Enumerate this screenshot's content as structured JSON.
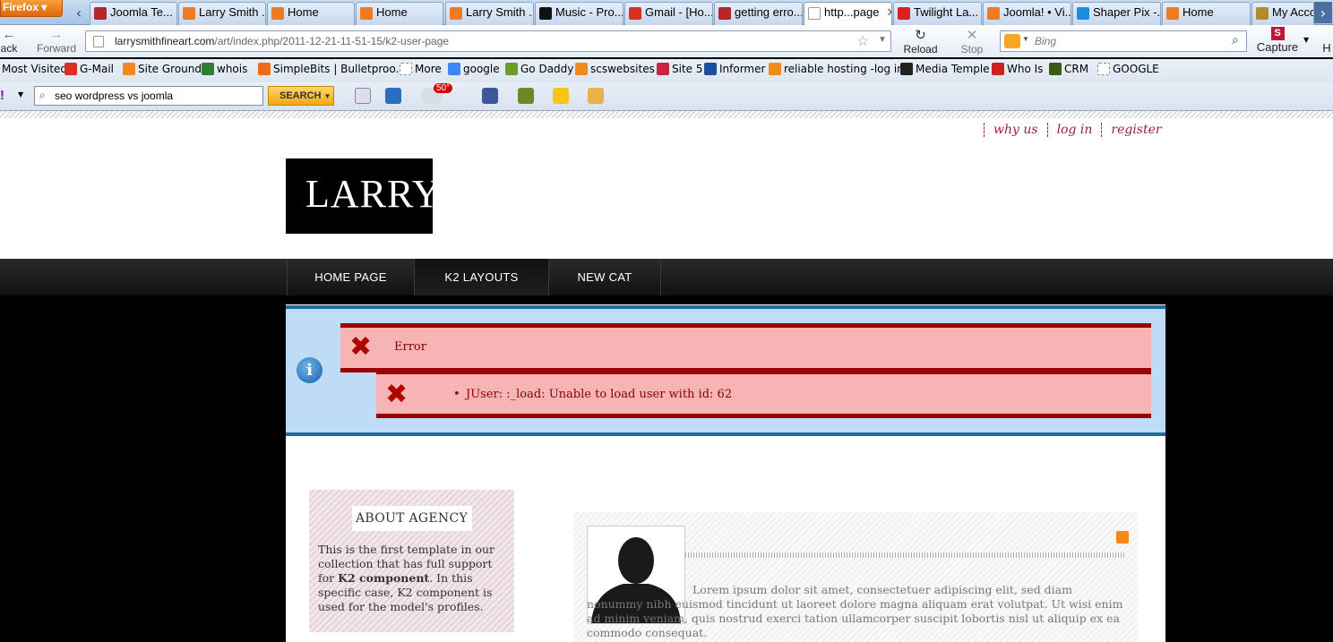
{
  "browser": {
    "app_button": "Firefox",
    "tabs": [
      {
        "label": "Joomla Te...",
        "icon": "pinterest-favicon",
        "color": "#b5262b"
      },
      {
        "label": "Larry Smith ...",
        "icon": "joomla-favicon",
        "color": "#ef7a1f"
      },
      {
        "label": "Home",
        "icon": "joomla-favicon",
        "color": "#ef7a1f"
      },
      {
        "label": "Home",
        "icon": "joomla-favicon",
        "color": "#ef7a1f"
      },
      {
        "label": "Larry Smith ...",
        "icon": "joomla-favicon",
        "color": "#ef7a1f"
      },
      {
        "label": "Music - Pro...",
        "icon": "g-favicon",
        "color": "#111111"
      },
      {
        "label": "Gmail - [Ho...",
        "icon": "gmail-favicon",
        "color": "#d93025"
      },
      {
        "label": "getting erro...",
        "icon": "pinterest-favicon",
        "color": "#b5262b"
      },
      {
        "label": "http...page",
        "icon": "blank-page-favicon",
        "color": "#ffffff",
        "active": true
      },
      {
        "label": "Twilight La...",
        "icon": "f-favicon",
        "color": "#e02020"
      },
      {
        "label": "Joomla! • Vi...",
        "icon": "joomla-favicon",
        "color": "#ef7a1f"
      },
      {
        "label": "Shaper Pix -...",
        "icon": "shaper-favicon",
        "color": "#1b8ee0"
      },
      {
        "label": "Home",
        "icon": "joomla-favicon",
        "color": "#ef7a1f"
      },
      {
        "label": "My Acco",
        "icon": "account-favicon",
        "color": "#b38b2c"
      }
    ],
    "nav": {
      "back": "ack",
      "forward": "Forward",
      "url_host": "larrysmithfineart.com",
      "url_path": "/art/index.php/2011-12-21-11-51-15/k2-user-page",
      "reload": "Reload",
      "stop": "Stop",
      "search_placeholder": "Bing",
      "capture": "Capture",
      "home": "H"
    },
    "bookmarks": [
      {
        "label": "Most Visited",
        "icon": "most-visited-icon",
        "color": "#c9d7ea"
      },
      {
        "label": "G-Mail",
        "icon": "gmail-icon",
        "color": "#d93025"
      },
      {
        "label": "Site Ground",
        "icon": "siteground-icon",
        "color": "#f08a1c"
      },
      {
        "label": "whois",
        "icon": "ns-icon",
        "color": "#2e7d32"
      },
      {
        "label": "SimpleBits | Bulletproo...",
        "icon": "sb-icon",
        "color": "#f06a1c"
      },
      {
        "label": "More",
        "icon": "page-icon",
        "color": "#ffffff"
      },
      {
        "label": "google",
        "icon": "google-icon",
        "color": "#4285f4"
      },
      {
        "label": "Go Daddy",
        "icon": "godaddy-icon",
        "color": "#6a9d2a"
      },
      {
        "label": "scswebsites",
        "icon": "cpanel-icon",
        "color": "#f08a1c"
      },
      {
        "label": "Site 5",
        "icon": "site5-icon",
        "color": "#cc2244"
      },
      {
        "label": "Informer",
        "icon": "joomla-icon",
        "color": "#1b4e9b"
      },
      {
        "label": "reliable hosting -log in",
        "icon": "cpanel-icon",
        "color": "#f08a1c"
      },
      {
        "label": "Media Temple",
        "icon": "mt-icon",
        "color": "#222222"
      },
      {
        "label": "Who Is",
        "icon": "whois-icon",
        "color": "#cc2222"
      },
      {
        "label": "CRM",
        "icon": "crm-icon",
        "color": "#3a5a1a"
      },
      {
        "label": "GOOGLE",
        "icon": "page-icon",
        "color": "#ffffff"
      }
    ],
    "yahoo_toolbar": {
      "query": "seo wordpress vs joomla",
      "search_button": "SEARCH",
      "weather": "50°"
    }
  },
  "site": {
    "top_links": [
      "why us",
      "log in",
      "register"
    ],
    "logo": "LARRY",
    "menu": [
      "HOME PAGE",
      "K2 LAYOUTS",
      "NEW CAT"
    ],
    "message": {
      "title": "Error",
      "detail": "JUser: :_load: Unable to load user with id: 62"
    },
    "about": {
      "title": "ABOUT AGENCY",
      "text_before": "This is the first template in our collection that has full support for ",
      "text_bold": "K2 component",
      "text_after": ". In this specific case, K2 component is used for the model's profiles."
    },
    "profile": {
      "bio": "Lorem ipsum dolor sit amet, consectetuer adipiscing elit, sed diam nonummy nibh euismod tincidunt ut laoreet dolore magna aliquam erat volutpat. Ut wisi enim ad minim veniam, quis nostrud exerci tation ullamcorper suscipit lobortis nisl ut aliquip ex ea commodo consequat."
    }
  }
}
